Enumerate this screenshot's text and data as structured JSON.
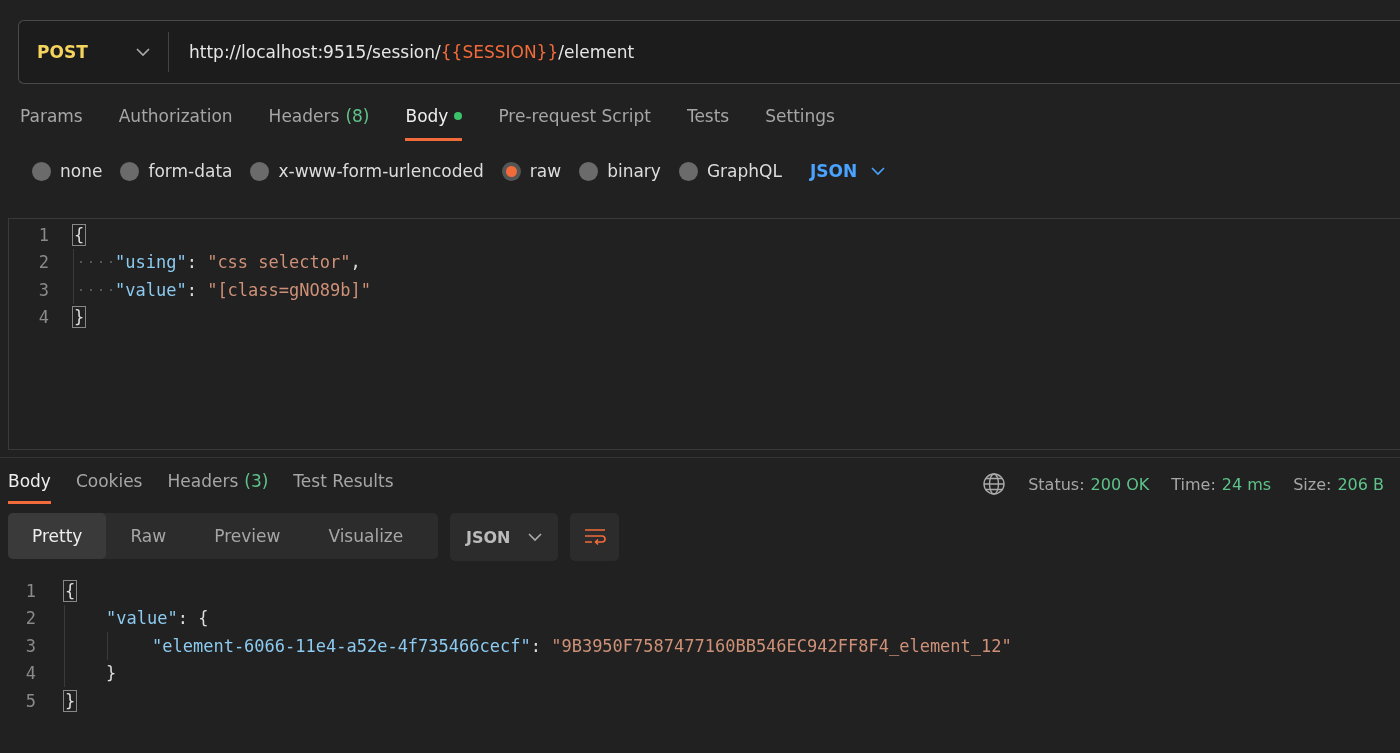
{
  "request": {
    "method": "POST",
    "url_parts": [
      {
        "kind": "plain",
        "text": "http://localhost:9515/session/"
      },
      {
        "kind": "variable",
        "text": "{{SESSION}}"
      },
      {
        "kind": "plain",
        "text": "/element"
      }
    ]
  },
  "request_tabs": [
    {
      "label": "Params",
      "selected": false
    },
    {
      "label": "Authorization",
      "selected": false
    },
    {
      "label": "Headers",
      "count": "(8)",
      "selected": false
    },
    {
      "label": "Body",
      "dot": true,
      "selected": true
    },
    {
      "label": "Pre-request Script",
      "selected": false
    },
    {
      "label": "Tests",
      "selected": false
    },
    {
      "label": "Settings",
      "selected": false
    }
  ],
  "body_types": [
    {
      "label": "none",
      "selected": false
    },
    {
      "label": "form-data",
      "selected": false
    },
    {
      "label": "x-www-form-urlencoded",
      "selected": false
    },
    {
      "label": "raw",
      "selected": true
    },
    {
      "label": "binary",
      "selected": false
    },
    {
      "label": "GraphQL",
      "selected": false
    }
  ],
  "body_format": "JSON",
  "request_body": {
    "whitespace_marks": true,
    "lines": [
      {
        "number": "1",
        "kind": "root",
        "tokens": [
          {
            "kind": "brace",
            "text": "{",
            "matched": true
          }
        ]
      },
      {
        "number": "2",
        "kind": "inner",
        "tokens": [
          {
            "kind": "key",
            "text": "\"using\""
          },
          {
            "kind": "punct",
            "text": ": "
          },
          {
            "kind": "string",
            "text": "\"css selector\""
          },
          {
            "kind": "punct",
            "text": ","
          }
        ]
      },
      {
        "number": "3",
        "kind": "inner",
        "tokens": [
          {
            "kind": "key",
            "text": "\"value\""
          },
          {
            "kind": "punct",
            "text": ": "
          },
          {
            "kind": "string",
            "text": "\"[class=gNO89b]\""
          }
        ]
      },
      {
        "number": "4",
        "kind": "root",
        "tokens": [
          {
            "kind": "brace",
            "text": "}",
            "matched": true
          }
        ]
      }
    ]
  },
  "response_tabs": [
    {
      "label": "Body",
      "selected": true
    },
    {
      "label": "Cookies",
      "selected": false
    },
    {
      "label": "Headers",
      "count": "(3)",
      "selected": false
    },
    {
      "label": "Test Results",
      "selected": false
    }
  ],
  "response_status": [
    {
      "label": "Status:",
      "value": "200 OK"
    },
    {
      "label": "Time:",
      "value": "24 ms"
    },
    {
      "label": "Size:",
      "value": "206 B"
    }
  ],
  "view_modes": [
    {
      "label": "Pretty",
      "selected": true
    },
    {
      "label": "Raw",
      "selected": false
    },
    {
      "label": "Preview",
      "selected": false
    },
    {
      "label": "Visualize",
      "selected": false
    }
  ],
  "response_format": "JSON",
  "response_body": {
    "whitespace_marks": false,
    "lines": [
      {
        "number": "1",
        "kind": "root",
        "tokens": [
          {
            "kind": "brace",
            "text": "{",
            "matched": true
          }
        ]
      },
      {
        "number": "2",
        "kind": "inner",
        "tokens": [
          {
            "kind": "key",
            "text": "\"value\""
          },
          {
            "kind": "punct",
            "text": ": {"
          }
        ]
      },
      {
        "number": "3",
        "kind": "deep",
        "tokens": [
          {
            "kind": "key",
            "text": "\"element-6066-11e4-a52e-4f735466cecf\""
          },
          {
            "kind": "punct",
            "text": ": "
          },
          {
            "kind": "string",
            "text": "\"9B3950F7587477160BB546EC942FF8F4_element_12\""
          }
        ]
      },
      {
        "number": "4",
        "kind": "inner",
        "tokens": [
          {
            "kind": "punct",
            "text": "}"
          }
        ]
      },
      {
        "number": "5",
        "kind": "root",
        "tokens": [
          {
            "kind": "brace",
            "text": "}",
            "matched": true
          }
        ]
      }
    ]
  }
}
